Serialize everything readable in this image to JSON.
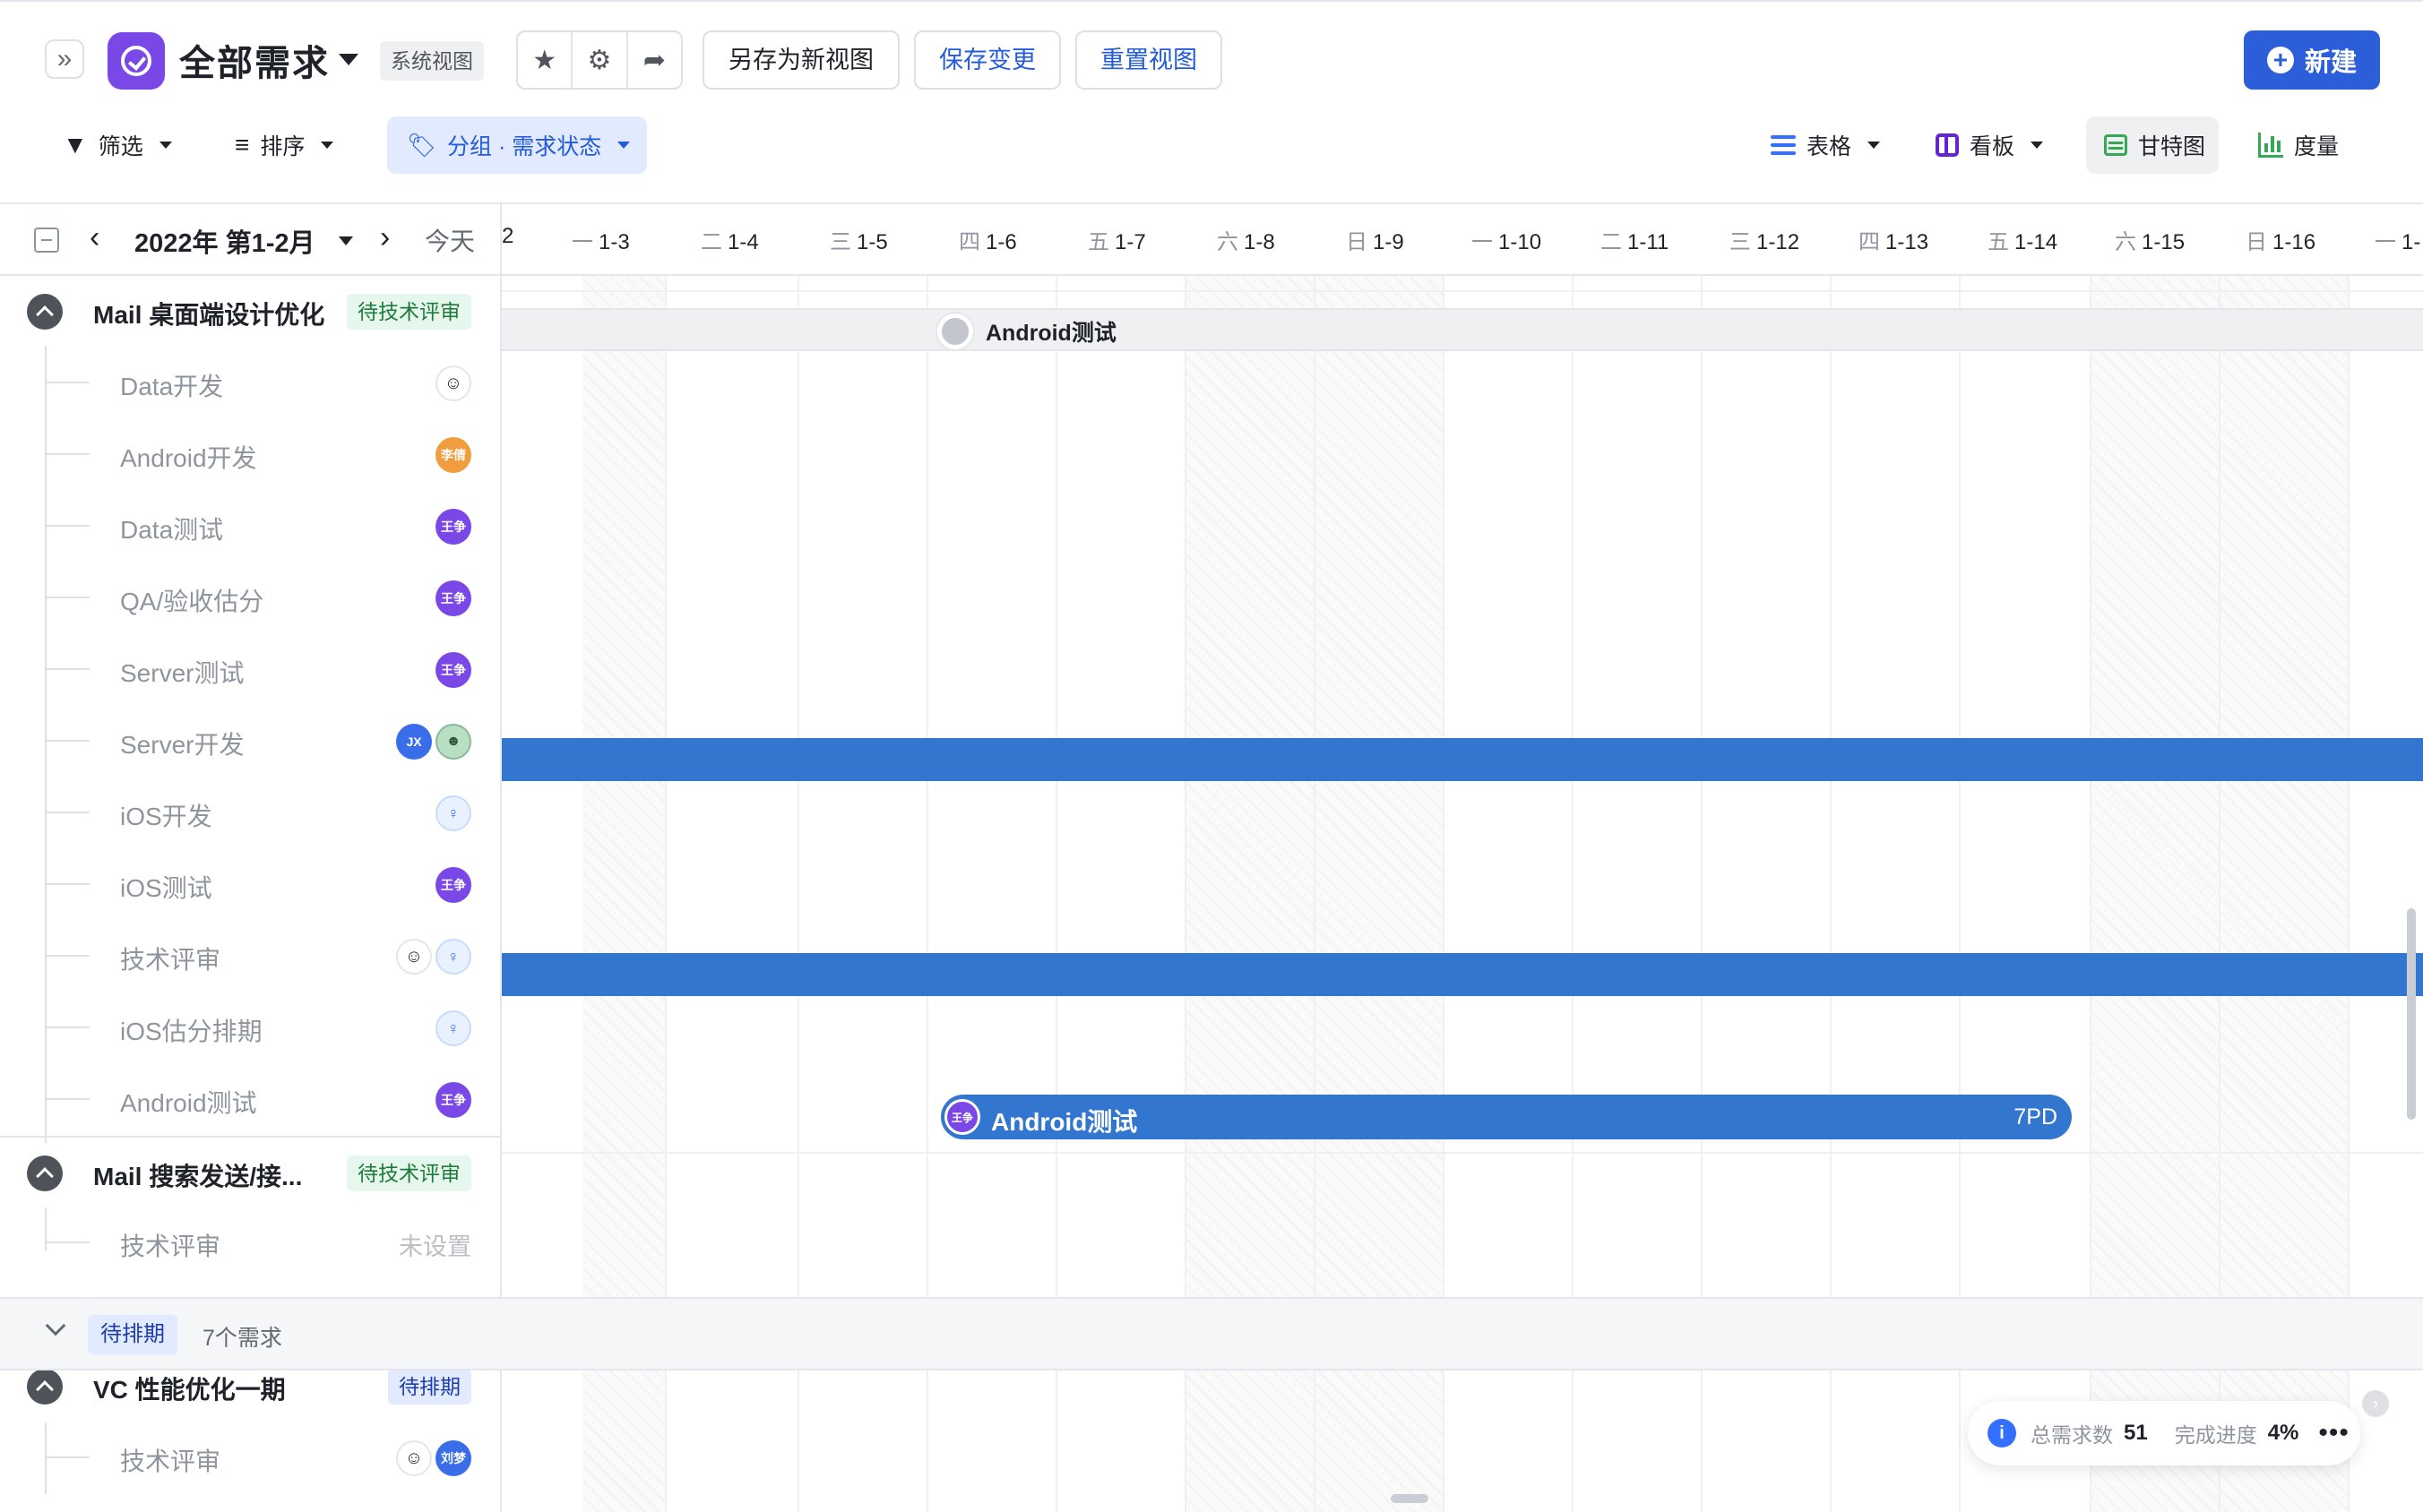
{
  "header": {
    "title": "全部需求",
    "view_type_tag": "系统视图",
    "save_as_label": "另存为新视图",
    "save_label": "保存变更",
    "reset_label": "重置视图",
    "new_label": "新建"
  },
  "toolbar": {
    "filter_label": "筛选",
    "sort_label": "排序",
    "group_label": "分组 · 需求状态",
    "views": {
      "table": "表格",
      "board": "看板",
      "gantt": "甘特图",
      "metric": "度量"
    }
  },
  "gantt": {
    "period_label": "2022年 第1-2月",
    "today_label": "今天",
    "days": [
      {
        "wk": "",
        "date": "2"
      },
      {
        "wk": "一",
        "date": "1-3"
      },
      {
        "wk": "二",
        "date": "1-4"
      },
      {
        "wk": "三",
        "date": "1-5"
      },
      {
        "wk": "四",
        "date": "1-6"
      },
      {
        "wk": "五",
        "date": "1-7"
      },
      {
        "wk": "六",
        "date": "1-8"
      },
      {
        "wk": "日",
        "date": "1-9"
      },
      {
        "wk": "一",
        "date": "1-10"
      },
      {
        "wk": "二",
        "date": "1-11"
      },
      {
        "wk": "三",
        "date": "1-12"
      },
      {
        "wk": "四",
        "date": "1-13"
      },
      {
        "wk": "五",
        "date": "1-14"
      },
      {
        "wk": "六",
        "date": "1-15"
      },
      {
        "wk": "日",
        "date": "1-16"
      },
      {
        "wk": "一",
        "date": "1-"
      }
    ]
  },
  "items": [
    {
      "title": "Mail 桌面端设计优化",
      "status": "待技术评审",
      "children": [
        {
          "title": "Data开发",
          "avatars": [
            "face"
          ]
        },
        {
          "title": "Android开发",
          "avatars": [
            "李倩"
          ]
        },
        {
          "title": "Data测试",
          "avatars": [
            "王争"
          ]
        },
        {
          "title": "QA/验收估分",
          "avatars": [
            "王争"
          ]
        },
        {
          "title": "Server测试",
          "avatars": [
            "王争"
          ]
        },
        {
          "title": "Server开发",
          "avatars": [
            "JX",
            "green"
          ]
        },
        {
          "title": "iOS开发",
          "avatars": [
            "girl"
          ]
        },
        {
          "title": "iOS测试",
          "avatars": [
            "王争"
          ]
        },
        {
          "title": "技术评审",
          "avatars": [
            "face",
            "girl"
          ]
        },
        {
          "title": "iOS估分排期",
          "avatars": [
            "girl"
          ]
        },
        {
          "title": "Android测试",
          "avatars": [
            "王争"
          ]
        }
      ]
    },
    {
      "title": "Mail 搜索发送/接...",
      "status": "待技术评审",
      "children": [
        {
          "title": "技术评审",
          "unset": "未设置"
        }
      ]
    }
  ],
  "group": {
    "label": "待排期",
    "count": "7个需求"
  },
  "items2": [
    {
      "title": "VC 性能优化一期",
      "status": "待排期",
      "children": [
        {
          "title": "技术评审",
          "avatars": [
            "face",
            "刘梦"
          ]
        }
      ]
    }
  ],
  "bars": {
    "milestone_label": "Android测试",
    "task_label": "Android测试",
    "task_avatar": "王争",
    "task_duration": "7PD"
  },
  "stats": {
    "total_label": "总需求数",
    "total_value": "51",
    "progress_label": "完成进度",
    "progress_value": "4%",
    "more": "•••"
  },
  "colors": {
    "accent": "#2b5ed8",
    "bar": "#3376d0",
    "app_icon": "#7b48e8"
  }
}
